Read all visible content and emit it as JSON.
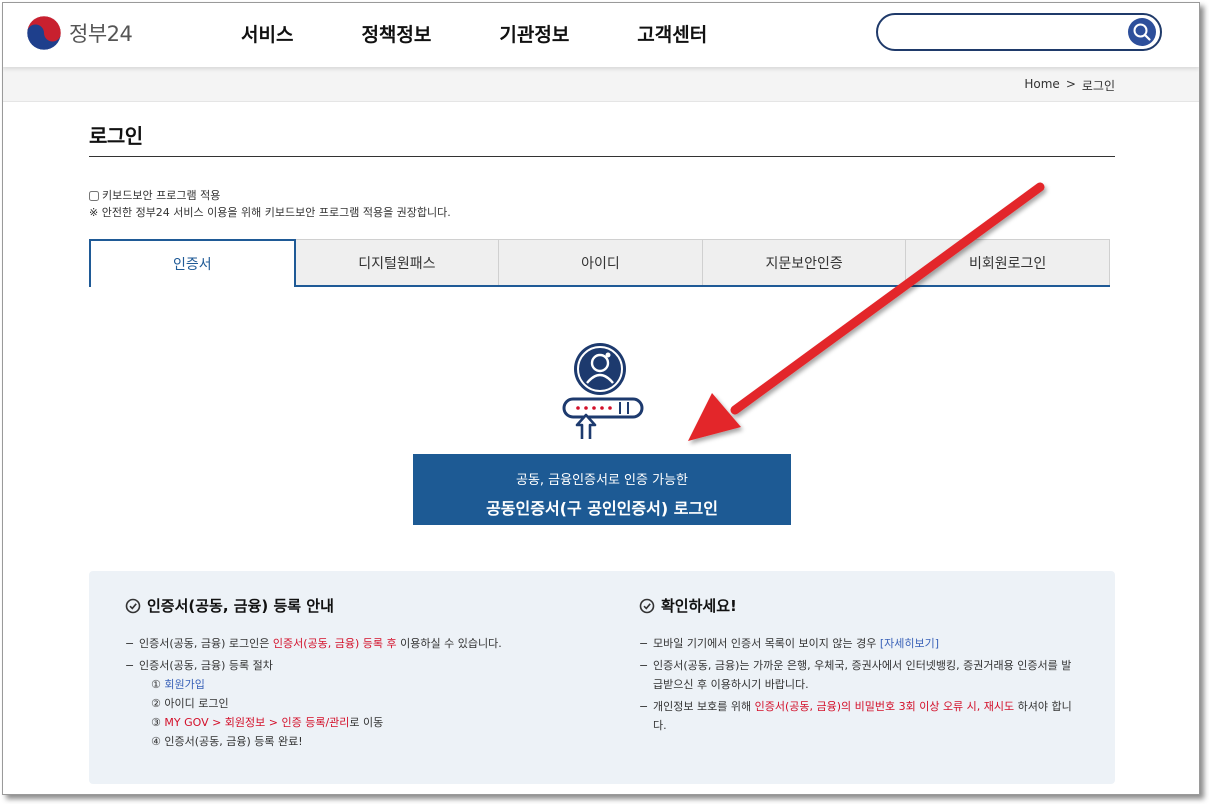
{
  "header": {
    "logo_text": "정부24",
    "nav": [
      "서비스",
      "정책정보",
      "기관정보",
      "고객센터"
    ],
    "search_placeholder": ""
  },
  "breadcrumb": {
    "home": "Home",
    "separator": ">",
    "current": "로그인"
  },
  "page_title": "로그인",
  "keyboard_security": {
    "checkbox_label": "키보드보안 프로그램 적용",
    "notice": "※ 안전한 정부24 서비스 이용을 위해 키보드보안 프로그램 적용을 권장합니다."
  },
  "tabs": [
    {
      "label": "인증서",
      "active": true
    },
    {
      "label": "디지털원패스",
      "active": false
    },
    {
      "label": "아이디",
      "active": false
    },
    {
      "label": "지문보안인증",
      "active": false
    },
    {
      "label": "비회원로그인",
      "active": false
    }
  ],
  "cert_button": {
    "subtitle": "공동, 금융인증서로 인증 가능한",
    "title": "공동인증서(구 공인인증서) 로그인"
  },
  "info_left": {
    "heading": "인증서(공동, 금융) 등록 안내",
    "item1": {
      "pre": "인증서(공동, 금융) 로그인은 ",
      "red": "인증서(공동, 금융) 등록 후",
      "post": " 이용하실 수 있습니다."
    },
    "item2": "인증서(공동, 금융) 등록 절차",
    "steps": {
      "s1_num": "①",
      "s1_text": "회원가입",
      "s2": "② 아이디 로그인",
      "s3_num": "③",
      "s3_red": "MY GOV > 회원정보 > 인증 등록/관리",
      "s3_post": "로 이동",
      "s4": "④ 인증서(공동, 금융) 등록 완료!"
    }
  },
  "info_right": {
    "heading": "확인하세요!",
    "item1": {
      "pre": "모바일 기기에서 인증서 목록이 보이지 않는 경우 ",
      "link": "[자세히보기]"
    },
    "item2": "인증서(공동, 금융)는 가까운 은행, 우체국, 증권사에서 인터넷뱅킹, 증권거래용 인증서를 발급받으신 후 이용하시기 바랍니다.",
    "item3": {
      "pre": "개인정보 보호를 위해 ",
      "red": "인증서(공동, 금융)의 비밀번호 3회 이상 오류 시, 재시도",
      "post": " 하셔야 합니다."
    }
  },
  "colors": {
    "primary": "#1d5a94",
    "arrow": "#e3262a",
    "info_bg": "#edf2f7",
    "red_text": "#d3102a"
  }
}
